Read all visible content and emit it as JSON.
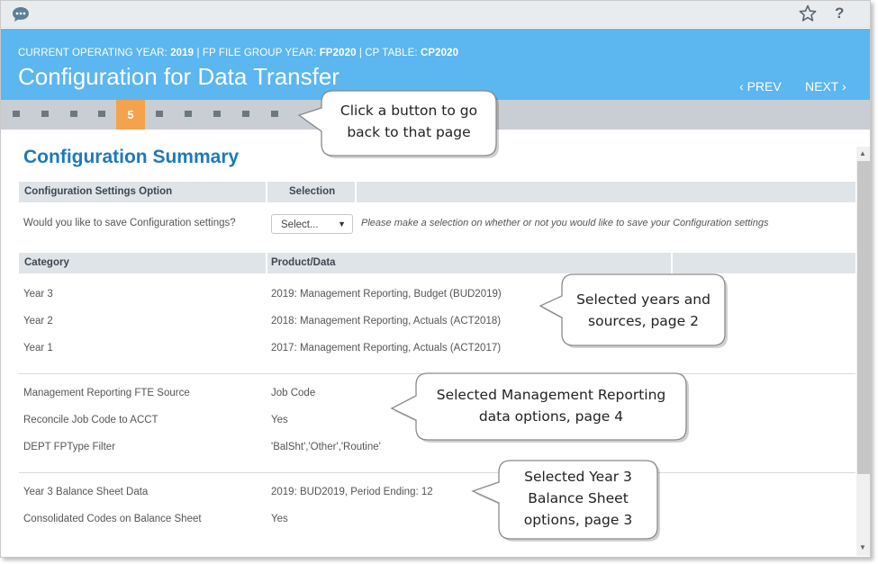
{
  "header": {
    "operating_year_label": "CURRENT OPERATING YEAR:",
    "operating_year": "2019",
    "fp_group_label": "| FP FILE GROUP YEAR:",
    "fp_group": "FP2020",
    "cp_table_label": "| CP TABLE:",
    "cp_table": "CP2020",
    "title": "Configuration for Data Transfer",
    "prev_label": "PREV",
    "next_label": "NEXT"
  },
  "steps": {
    "active": "5"
  },
  "summary": {
    "title": "Configuration Summary",
    "settings_header": {
      "option": "Configuration Settings Option",
      "selection": "Selection"
    },
    "settings_question": "Would you like to save Configuration settings?",
    "select_value": "Select...",
    "settings_hint": "Please make a selection on whether or not you would like to save your Configuration settings",
    "table_header": {
      "category": "Category",
      "product": "Product/Data"
    },
    "groups": [
      {
        "rows": [
          {
            "category": "Year 3",
            "value": "2019: Management Reporting, Budget (BUD2019)"
          },
          {
            "category": "Year 2",
            "value": "2018: Management Reporting, Actuals (ACT2018)"
          },
          {
            "category": "Year 1",
            "value": "2017: Management Reporting, Actuals (ACT2017)"
          }
        ]
      },
      {
        "rows": [
          {
            "category": "Management Reporting FTE Source",
            "value": "Job Code"
          },
          {
            "category": "Reconcile Job Code to ACCT",
            "value": "Yes"
          },
          {
            "category": "DEPT FPType Filter",
            "value": "'BalSht','Other','Routine'"
          }
        ]
      },
      {
        "rows": [
          {
            "category": "Year 3 Balance Sheet Data",
            "value": "2019: BUD2019, Period Ending: 12"
          },
          {
            "category": "Consolidated Codes on Balance Sheet",
            "value": "Yes"
          }
        ]
      }
    ]
  },
  "callouts": {
    "steps": {
      "line1": "Click a button to go",
      "line2": "back to that page"
    },
    "years": {
      "line1": "Selected years and",
      "line2": "sources, page 2"
    },
    "mgmt": {
      "line1": "Selected Management Reporting",
      "line2": "data options, page 4"
    },
    "balance": {
      "line1": "Selected Year 3",
      "line2": "Balance Sheet",
      "line3": "options, page 3"
    }
  },
  "icons": {
    "chat": "chat-bubble-icon",
    "star": "star-outline-icon",
    "help": "question-icon"
  },
  "colors": {
    "header_blue": "#5cb6f0",
    "active_step": "#f5a24c",
    "title_blue": "#1d7ab8"
  }
}
